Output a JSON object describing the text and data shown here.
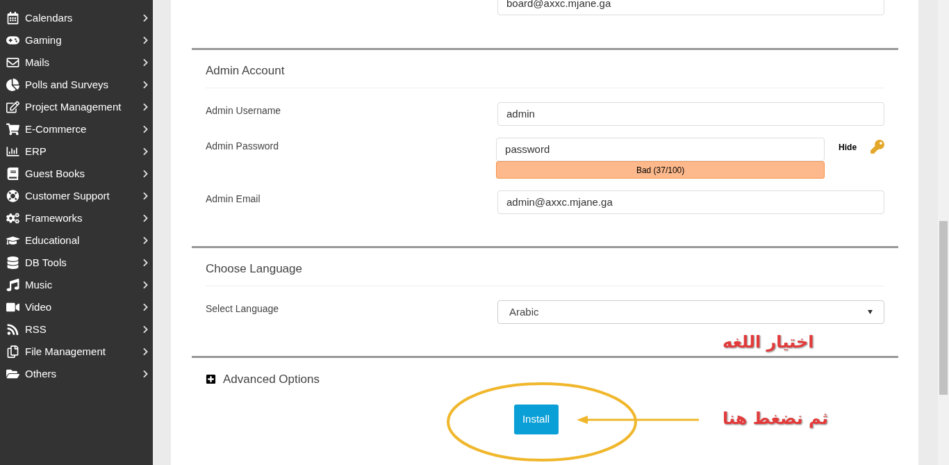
{
  "sidebar": {
    "items": [
      {
        "label": "Calendars"
      },
      {
        "label": "Gaming"
      },
      {
        "label": "Mails"
      },
      {
        "label": "Polls and Surveys"
      },
      {
        "label": "Project Management"
      },
      {
        "label": "E-Commerce"
      },
      {
        "label": "ERP"
      },
      {
        "label": "Guest Books"
      },
      {
        "label": "Customer Support"
      },
      {
        "label": "Frameworks"
      },
      {
        "label": "Educational"
      },
      {
        "label": "DB Tools"
      },
      {
        "label": "Music"
      },
      {
        "label": "Video"
      },
      {
        "label": "RSS"
      },
      {
        "label": "File Management"
      },
      {
        "label": "Others"
      }
    ]
  },
  "board_email": {
    "value": "board@axxc.mjane.ga"
  },
  "admin_account": {
    "title": "Admin Account",
    "username": {
      "label": "Admin Username",
      "value": "admin"
    },
    "password": {
      "label": "Admin Password",
      "value": "password",
      "toggle": "Hide",
      "strength": "Bad (37/100)"
    },
    "email": {
      "label": "Admin Email",
      "value": "admin@axxc.mjane.ga"
    }
  },
  "choose_language": {
    "title": "Choose Language",
    "label": "Select Language",
    "value": "Arabic"
  },
  "advanced_options": {
    "label": "Advanced Options",
    "expanded": false
  },
  "install_button": "Install",
  "annotations": [
    {
      "text": "اختيار اللغه"
    },
    {
      "text": "ثم نضغط هنا"
    }
  ]
}
